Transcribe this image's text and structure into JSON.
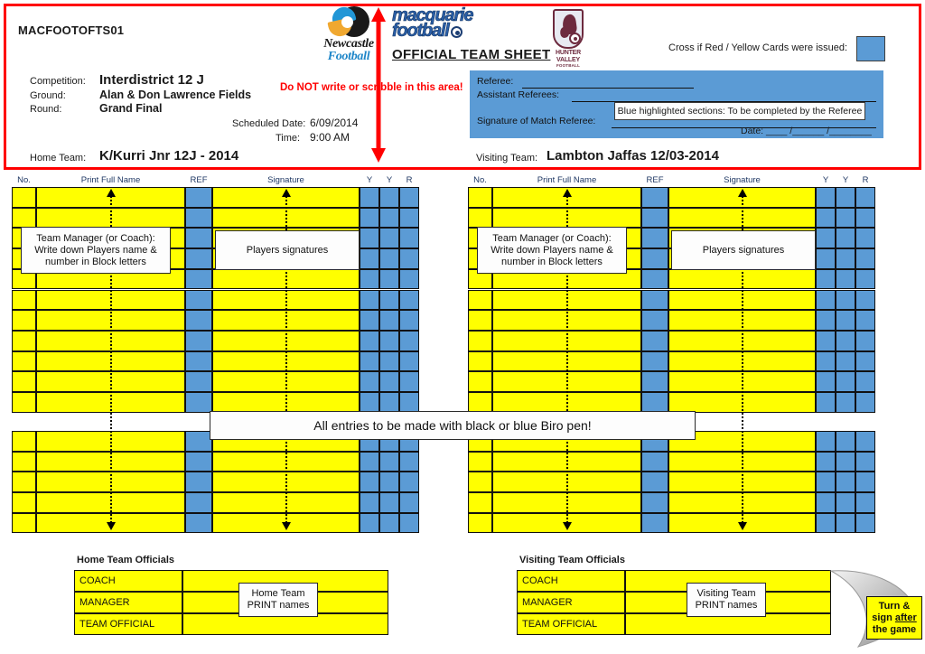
{
  "doc_code": "MACFOOTOFTS01",
  "header": {
    "official_title": "OFFICIAL TEAM SHEET",
    "warning": "Do NOT write or scribble in this area!",
    "cards_label": "Cross if Red / Yellow Cards were issued:",
    "logos": {
      "newcastle_line1": "Newcastle",
      "newcastle_line2": "Football",
      "macquarie_line1": "macquarie",
      "macquarie_line2": "football",
      "hunter_line1": "HUNTER",
      "hunter_line2": "VALLEY",
      "hunter_line3": "FOOTBALL"
    }
  },
  "match": {
    "competition_label": "Competition:",
    "competition_value": "Interdistrict 12 J",
    "ground_label": "Ground:",
    "ground_value": "Alan & Don Lawrence Fields",
    "round_label": "Round:",
    "round_value": "Grand Final",
    "date_label": "Scheduled Date:",
    "date_value": "6/09/2014",
    "time_label": "Time:",
    "time_value": "9:00 AM",
    "home_team_label": "Home Team:",
    "home_team_value": "K/Kurri Jnr 12J - 2014",
    "visiting_team_label": "Visiting Team:",
    "visiting_team_value": "Lambton Jaffas 12/03-2014"
  },
  "referee": {
    "referee_label": "Referee:",
    "assistants_label": "Assistant Referees:",
    "signature_label": "Signature of Match Referee:",
    "date_label": "Date:  ____ /______ /________",
    "tip": "Blue highlighted sections: To be completed by the Referee"
  },
  "table": {
    "headers": [
      "No.",
      "Print Full Name",
      "REF",
      "Signature",
      "Y",
      "Y",
      "R"
    ],
    "rows_upper": 11,
    "rows_lower": 5,
    "callout_manager": "Team Manager (or Coach):\nWrite down Players name &\nnumber in Block letters",
    "callout_signatures": "Players signatures"
  },
  "banner": {
    "biro": "All entries to be made with black or blue Biro pen!"
  },
  "officials": {
    "home_title": "Home Team Officials",
    "visiting_title": "Visiting Team Officials",
    "roles": [
      "COACH",
      "MANAGER",
      "TEAM OFFICIAL"
    ],
    "home_callout": "Home Team\nPRINT names",
    "visiting_callout": "Visiting Team\nPRINT names"
  },
  "turn_note": {
    "line1": "Turn &",
    "line2a": "sign ",
    "line2b": "after",
    "line3": "the game"
  },
  "colors": {
    "yellow": "#ffff00",
    "blue": "#5b9bd5",
    "red": "#ff0000",
    "header_text": "#1f3864"
  }
}
